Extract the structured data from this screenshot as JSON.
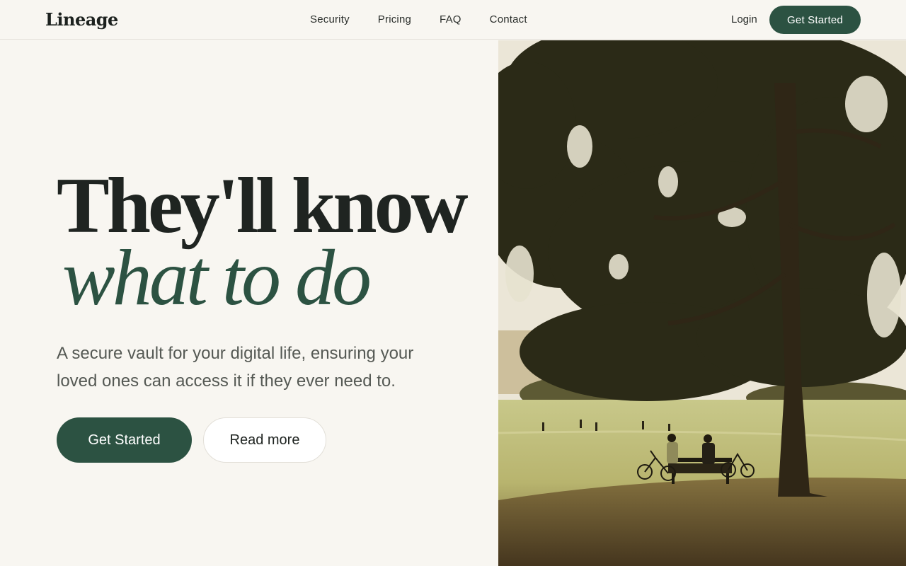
{
  "brand": {
    "logo": "Lineage"
  },
  "nav": {
    "items": [
      "Security",
      "Pricing",
      "FAQ",
      "Contact"
    ]
  },
  "header": {
    "login": "Login",
    "cta": "Get Started"
  },
  "hero": {
    "headline": "They'll know",
    "headline_accent": "what to do",
    "subtitle": "A secure vault for your digital life, ensuring your loved ones can access it if they ever need to.",
    "primary_cta": "Get Started",
    "secondary_cta": "Read more"
  },
  "colors": {
    "accent": "#2c5242",
    "background": "#f8f6f1",
    "text": "#1f2421"
  },
  "image": {
    "subject": "park-tree-bench-photo"
  }
}
